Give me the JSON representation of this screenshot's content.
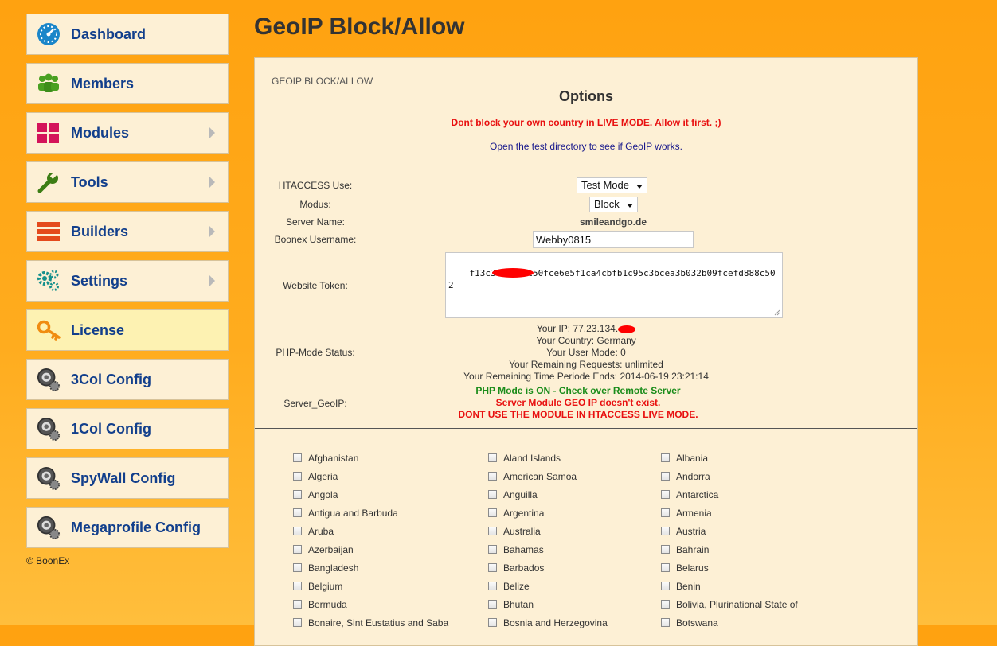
{
  "sidebar": {
    "items": [
      {
        "label": "Dashboard",
        "icon": "dashboard-gauge-icon",
        "has_arrow": false
      },
      {
        "label": "Members",
        "icon": "members-icon",
        "has_arrow": false
      },
      {
        "label": "Modules",
        "icon": "modules-grid-icon",
        "has_arrow": true
      },
      {
        "label": "Tools",
        "icon": "wrench-icon",
        "has_arrow": true
      },
      {
        "label": "Builders",
        "icon": "builders-bars-icon",
        "has_arrow": true
      },
      {
        "label": "Settings",
        "icon": "gears-icon",
        "has_arrow": true
      },
      {
        "label": "License",
        "icon": "key-icon",
        "has_arrow": false
      },
      {
        "label": "3Col Config",
        "icon": "gear-magnifier-icon",
        "has_arrow": false
      },
      {
        "label": "1Col Config",
        "icon": "gear-magnifier-icon",
        "has_arrow": false
      },
      {
        "label": "SpyWall Config",
        "icon": "gear-magnifier-icon",
        "has_arrow": false
      },
      {
        "label": "Megaprofile Config",
        "icon": "gear-magnifier-icon",
        "has_arrow": false
      }
    ],
    "copyright": "© BoonEx"
  },
  "page": {
    "title": "GeoIP Block/Allow"
  },
  "panel": {
    "caption": "GEOIP BLOCK/ALLOW",
    "heading": "Options",
    "warning": "Dont block your own country in LIVE MODE. Allow it first. ;)",
    "test_link": "Open the test directory to see if GeoIP works."
  },
  "form": {
    "htaccess_label": "HTACCESS Use:",
    "htaccess_value": "Test Mode",
    "modus_label": "Modus:",
    "modus_value": "Block",
    "server_name_label": "Server Name:",
    "server_name_value": "smileandgo.de",
    "username_label": "Boonex Username:",
    "username_value": "Webby0815",
    "token_label": "Website Token:",
    "token_value": "f13c3403584c50fce6e5f1ca4cbfb1c95c3bcea3b032b09fcefd888c502",
    "php_status_label": "PHP-Mode Status:",
    "status": {
      "ip": "Your IP: 77.23.134.",
      "country": "Your Country: Germany",
      "user_mode": "Your User Mode: 0",
      "requests": "Your Remaining Requests: unlimited",
      "time": "Your Remaining Time Periode Ends: 2014-06-19 23:21:14"
    },
    "server_geoip_label": "Server_GeoIP:",
    "geoip": {
      "php_mode": "PHP Mode is ON - Check over Remote Server",
      "module_missing": "Server Module GEO IP doesn't exist.",
      "dont_use": "DONT USE THE MODULE IN HTACCESS LIVE MODE."
    }
  },
  "countries": [
    [
      "Afghanistan",
      "Aland Islands",
      "Albania"
    ],
    [
      "Algeria",
      "American Samoa",
      "Andorra"
    ],
    [
      "Angola",
      "Anguilla",
      "Antarctica"
    ],
    [
      "Antigua and Barbuda",
      "Argentina",
      "Armenia"
    ],
    [
      "Aruba",
      "Australia",
      "Austria"
    ],
    [
      "Azerbaijan",
      "Bahamas",
      "Bahrain"
    ],
    [
      "Bangladesh",
      "Barbados",
      "Belarus"
    ],
    [
      "Belgium",
      "Belize",
      "Benin"
    ],
    [
      "Bermuda",
      "Bhutan",
      "Bolivia, Plurinational State of"
    ],
    [
      "Bonaire, Sint Eustatius and Saba",
      "Bosnia and Herzegovina",
      "Botswana"
    ]
  ],
  "colors": {
    "accent": "#123f8c",
    "warning": "#e81010",
    "ok": "#1a8c1a",
    "panel": "#fdf0d5",
    "background": "#ffa210"
  }
}
